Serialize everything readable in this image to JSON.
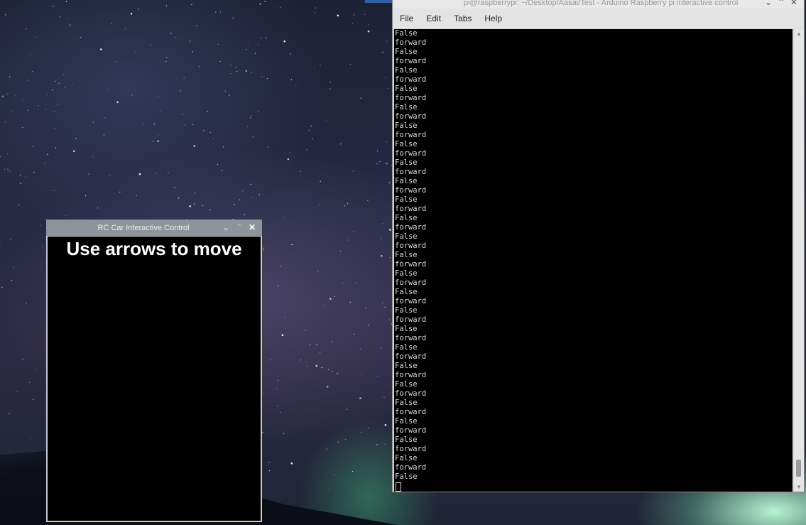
{
  "terminal": {
    "title": "pi@raspberrypi: ~/Desktop/Aasai/Test - Arduino Raspberry pi interactive control",
    "menu": [
      "File",
      "Edit",
      "Tabs",
      "Help"
    ],
    "output_lines": [
      "False",
      "forward",
      "False",
      "forward",
      "False",
      "forward",
      "False",
      "forward",
      "False",
      "forward",
      "False",
      "forward",
      "False",
      "forward",
      "False",
      "forward",
      "False",
      "forward",
      "False",
      "forward",
      "False",
      "forward",
      "False",
      "forward",
      "False",
      "forward",
      "False",
      "forward",
      "False",
      "forward",
      "False",
      "forward",
      "False",
      "forward",
      "False",
      "forward",
      "False",
      "forward",
      "False",
      "forward",
      "False",
      "forward",
      "False",
      "forward",
      "False",
      "forward",
      "False",
      "forward",
      "False"
    ]
  },
  "rc_window": {
    "title": "RC Car Interactive Control",
    "instruction": "Use arrows to move"
  },
  "icons": {
    "minimize": "chevron-down-icon",
    "maximize": "chevron-up-icon",
    "close": "close-icon"
  }
}
